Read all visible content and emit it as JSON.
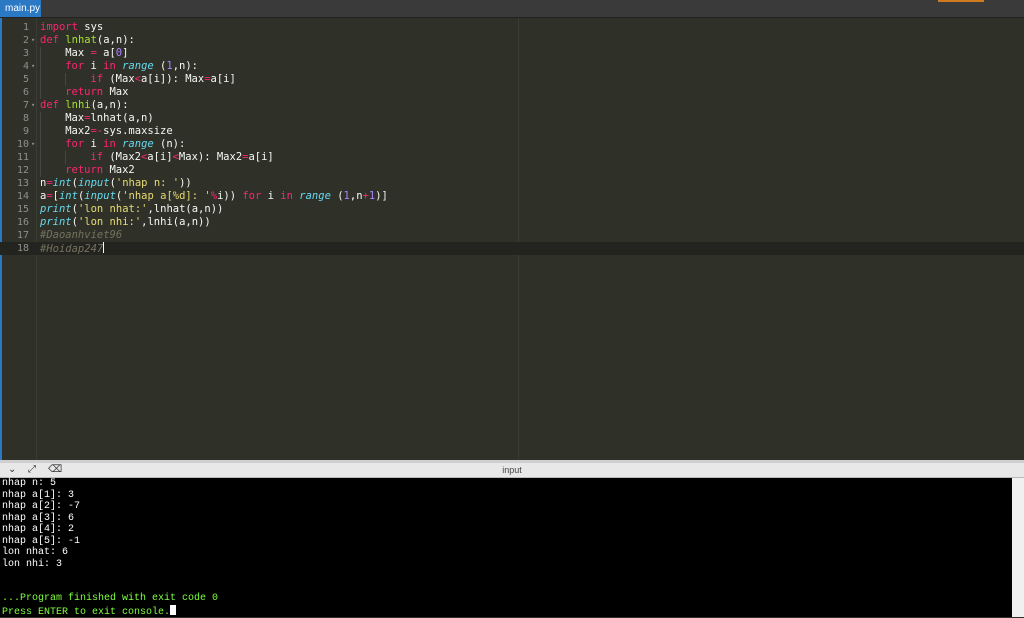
{
  "editor": {
    "tab_label": "main.py",
    "lines": [
      {
        "n": "1",
        "fold": false,
        "indent": 0,
        "tokens": [
          [
            "k",
            "import"
          ],
          [
            "w",
            " sys"
          ]
        ]
      },
      {
        "n": "2",
        "fold": true,
        "indent": 0,
        "tokens": [
          [
            "k",
            "def"
          ],
          [
            "w",
            " "
          ],
          [
            "f",
            "lnhat"
          ],
          [
            "w",
            "(a,n):"
          ]
        ]
      },
      {
        "n": "3",
        "fold": false,
        "indent": 1,
        "tokens": [
          [
            "w",
            "Max "
          ],
          [
            "o",
            "="
          ],
          [
            "w",
            " a["
          ],
          [
            "n",
            "0"
          ],
          [
            "w",
            "]"
          ]
        ]
      },
      {
        "n": "4",
        "fold": true,
        "indent": 1,
        "tokens": [
          [
            "k",
            "for"
          ],
          [
            "w",
            " i "
          ],
          [
            "k",
            "in"
          ],
          [
            "w",
            " "
          ],
          [
            "b",
            "range"
          ],
          [
            "w",
            " ("
          ],
          [
            "n",
            "1"
          ],
          [
            "w",
            ",n):"
          ]
        ]
      },
      {
        "n": "5",
        "fold": false,
        "indent": 2,
        "tokens": [
          [
            "k",
            "if"
          ],
          [
            "w",
            " (Max"
          ],
          [
            "o",
            "<"
          ],
          [
            "w",
            "a[i]): Max"
          ],
          [
            "o",
            "="
          ],
          [
            "w",
            "a[i]"
          ]
        ]
      },
      {
        "n": "6",
        "fold": false,
        "indent": 1,
        "tokens": [
          [
            "k",
            "return"
          ],
          [
            "w",
            " Max"
          ]
        ]
      },
      {
        "n": "7",
        "fold": true,
        "indent": 0,
        "tokens": [
          [
            "k",
            "def"
          ],
          [
            "w",
            " "
          ],
          [
            "f",
            "lnhi"
          ],
          [
            "w",
            "(a,n):"
          ]
        ]
      },
      {
        "n": "8",
        "fold": false,
        "indent": 1,
        "tokens": [
          [
            "w",
            "Max"
          ],
          [
            "o",
            "="
          ],
          [
            "w",
            "lnhat(a,n)"
          ]
        ]
      },
      {
        "n": "9",
        "fold": false,
        "indent": 1,
        "tokens": [
          [
            "w",
            "Max2"
          ],
          [
            "o",
            "=-"
          ],
          [
            "w",
            "sys.maxsize"
          ]
        ]
      },
      {
        "n": "10",
        "fold": true,
        "indent": 1,
        "tokens": [
          [
            "k",
            "for"
          ],
          [
            "w",
            " i "
          ],
          [
            "k",
            "in"
          ],
          [
            "w",
            " "
          ],
          [
            "b",
            "range"
          ],
          [
            "w",
            " (n):"
          ]
        ]
      },
      {
        "n": "11",
        "fold": false,
        "indent": 2,
        "tokens": [
          [
            "k",
            "if"
          ],
          [
            "w",
            " (Max2"
          ],
          [
            "o",
            "<"
          ],
          [
            "w",
            "a[i]"
          ],
          [
            "o",
            "<"
          ],
          [
            "w",
            "Max): Max2"
          ],
          [
            "o",
            "="
          ],
          [
            "w",
            "a[i]"
          ]
        ]
      },
      {
        "n": "12",
        "fold": false,
        "indent": 1,
        "tokens": [
          [
            "k",
            "return"
          ],
          [
            "w",
            " Max2"
          ]
        ]
      },
      {
        "n": "13",
        "fold": false,
        "indent": 0,
        "tokens": [
          [
            "w",
            "n"
          ],
          [
            "o",
            "="
          ],
          [
            "b",
            "int"
          ],
          [
            "w",
            "("
          ],
          [
            "b",
            "input"
          ],
          [
            "w",
            "("
          ],
          [
            "s",
            "'nhap n: '"
          ],
          [
            "w",
            "))"
          ]
        ]
      },
      {
        "n": "14",
        "fold": false,
        "indent": 0,
        "tokens": [
          [
            "w",
            "a"
          ],
          [
            "o",
            "="
          ],
          [
            "w",
            "["
          ],
          [
            "b",
            "int"
          ],
          [
            "w",
            "("
          ],
          [
            "b",
            "input"
          ],
          [
            "w",
            "("
          ],
          [
            "s",
            "'nhap a[%d]: '"
          ],
          [
            "o",
            "%"
          ],
          [
            "w",
            "i)) "
          ],
          [
            "k",
            "for"
          ],
          [
            "w",
            " i "
          ],
          [
            "k",
            "in"
          ],
          [
            "w",
            " "
          ],
          [
            "b",
            "range"
          ],
          [
            "w",
            " ("
          ],
          [
            "n",
            "1"
          ],
          [
            "w",
            ",n"
          ],
          [
            "o",
            "+"
          ],
          [
            "n",
            "1"
          ],
          [
            "w",
            ")]"
          ]
        ]
      },
      {
        "n": "15",
        "fold": false,
        "indent": 0,
        "tokens": [
          [
            "b",
            "print"
          ],
          [
            "w",
            "("
          ],
          [
            "s",
            "'lon nhat:'"
          ],
          [
            "w",
            ",lnhat(a,n))"
          ]
        ]
      },
      {
        "n": "16",
        "fold": false,
        "indent": 0,
        "tokens": [
          [
            "b",
            "print"
          ],
          [
            "w",
            "("
          ],
          [
            "s",
            "'lon nhi:'"
          ],
          [
            "w",
            ",lnhi(a,n))"
          ]
        ]
      },
      {
        "n": "17",
        "fold": false,
        "indent": 0,
        "tokens": [
          [
            "c",
            "#Daoanhviet96"
          ]
        ]
      },
      {
        "n": "18",
        "fold": false,
        "indent": 0,
        "active": true,
        "tokens": [
          [
            "c",
            "#Hoidap247"
          ]
        ]
      }
    ]
  },
  "console": {
    "title": "input",
    "toolbar": {
      "collapse_icon": "chevron-down-icon",
      "expand_icon": "expand-icon",
      "clear_icon": "clear-console-icon"
    },
    "lines": [
      {
        "text": "nhap n: 5",
        "color": "white"
      },
      {
        "text": "nhap a[1]: 3",
        "color": "white"
      },
      {
        "text": "nhap a[2]: -7",
        "color": "white"
      },
      {
        "text": "nhap a[3]: 6",
        "color": "white"
      },
      {
        "text": "nhap a[4]: 2",
        "color": "white"
      },
      {
        "text": "nhap a[5]: -1",
        "color": "white"
      },
      {
        "text": "lon nhat: 6",
        "color": "white"
      },
      {
        "text": "lon nhi: 3",
        "color": "white"
      },
      {
        "text": "",
        "color": "white"
      },
      {
        "text": "",
        "color": "white"
      },
      {
        "text": "...Program finished with exit code 0",
        "color": "green"
      },
      {
        "text": "Press ENTER to exit console.",
        "color": "green",
        "cursor": true
      }
    ]
  }
}
